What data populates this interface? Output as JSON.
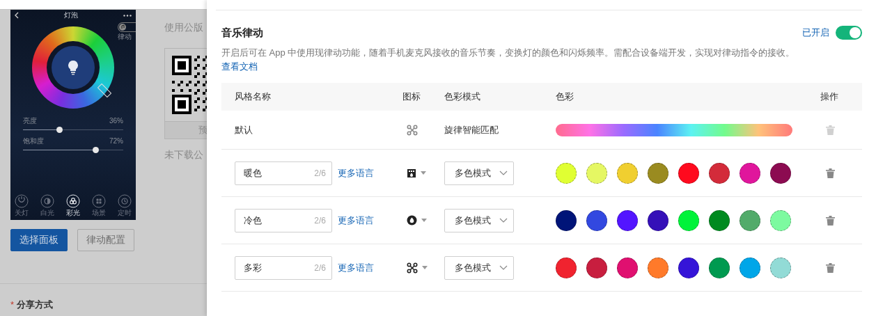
{
  "preview": {
    "title": "灯泡",
    "music_label": "律动",
    "sliders": [
      {
        "label": "亮度",
        "reading": "36%",
        "level": 0.36
      },
      {
        "label": "饱和度",
        "reading": "72%",
        "level": 0.72
      }
    ],
    "modes": [
      {
        "label": "关灯",
        "kind": "power",
        "selected": false
      },
      {
        "label": "白光",
        "kind": "half",
        "selected": false
      },
      {
        "label": "彩光",
        "kind": "color",
        "selected": true
      },
      {
        "label": "场景",
        "kind": "grid",
        "selected": false
      },
      {
        "label": "定时",
        "kind": "clock",
        "selected": false
      }
    ]
  },
  "panel_buttons": [
    {
      "label": "选择面板",
      "kind": "primary"
    },
    {
      "label": "律动配置",
      "kind": "default"
    }
  ],
  "public_panel": {
    "heading": "使用公版",
    "qr_caption": "预",
    "note": "未下载公"
  },
  "share": {
    "required_mark": "*",
    "label": "分享方式"
  },
  "drawer": {
    "title": "音乐律动",
    "status": "已开启",
    "on": true,
    "description": "开启后可在 App 中使用现律动功能，随着手机麦克风接收的音乐节奏，变换灯的颜色和闪烁频率。需配合设备端开发，实现对律动指令的接收。",
    "doc_link": "查看文档",
    "table": {
      "columns": [
        "风格名称",
        "图标",
        "色彩模式",
        "色彩",
        "操作"
      ],
      "rows": [
        {
          "kind": "default",
          "name": "默认",
          "mode": "旋律智能匹配",
          "delete_disabled": true
        },
        {
          "kind": "custom",
          "name": "暖色",
          "counter": "2/6",
          "more_link": "更多语言",
          "mode": "多色模式",
          "colors": [
            {
              "color": "#e0ff33"
            },
            {
              "color": "#e5f763"
            },
            {
              "color": "#f0cf30"
            },
            {
              "color": "#9a8b20"
            },
            {
              "color": "#ff0a1e"
            },
            {
              "color": "#d32b3a"
            },
            {
              "color": "#e0169c"
            },
            {
              "color": "#8c0b51"
            }
          ],
          "delete_disabled": false
        },
        {
          "kind": "custom",
          "name": "冷色",
          "counter": "2/6",
          "more_link": "更多语言",
          "mode": "多色模式",
          "colors": [
            {
              "color": "#001478"
            },
            {
              "color": "#3248e0"
            },
            {
              "color": "#5315ff"
            },
            {
              "color": "#3510b8"
            },
            {
              "color": "#00f33a"
            },
            {
              "color": "#008a1f"
            },
            {
              "color": "#52ab6a"
            },
            {
              "color": "#7dfaa0"
            }
          ],
          "delete_disabled": false
        },
        {
          "kind": "custom",
          "name": "多彩",
          "counter": "2/6",
          "more_link": "更多语言",
          "mode": "多色模式",
          "colors": [
            {
              "color": "#f0232f"
            },
            {
              "color": "#c81e3f"
            },
            {
              "color": "#e01070"
            },
            {
              "color": "#ff7a2a"
            },
            {
              "color": "#3514d8"
            },
            {
              "color": "#009a50"
            },
            {
              "color": "#00a6e8"
            },
            {
              "color": "#92dbd6"
            }
          ],
          "delete_disabled": false
        }
      ]
    }
  }
}
